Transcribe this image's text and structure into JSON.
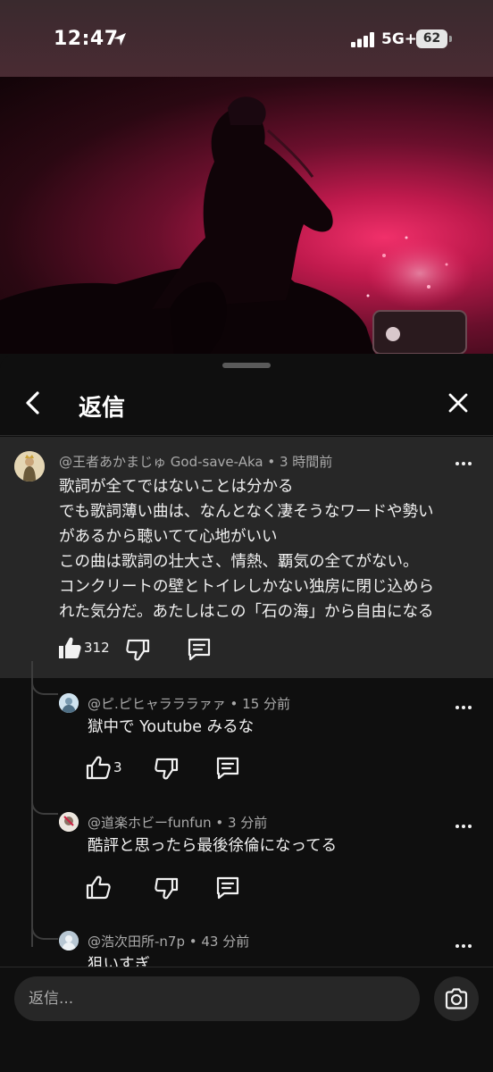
{
  "status_bar": {
    "time": "12:47",
    "network": "5G+",
    "battery": "62"
  },
  "sheet": {
    "title": "返信",
    "back_icon": "chevron-left-icon",
    "close_icon": "close-icon"
  },
  "main_comment": {
    "author": "@王者あかまじゅ God-save-Aka",
    "time": "3 時間前",
    "meta": "@王者あかまじゅ God-save-Aka • 3 時間前",
    "lines": [
      "歌詞が全てではないことは分かる",
      "でも歌詞薄い曲は、なんとなく凄そうなワードや勢い",
      "があるから聴いてて心地がいい",
      "この曲は歌詞の壮大さ、情熱、覇気の全てがない。",
      "コンクリートの壁とトイレしかない独房に閉じ込めら",
      "れた気分だ。あたしはこの「石の海」から自由になる"
    ],
    "likes": "312"
  },
  "replies": [
    {
      "author": "@ピ.ピヒャラララァァ",
      "time": "15 分前",
      "meta": "@ピ.ピヒャラララァァ • 15 分前",
      "text": "獄中で Youtube みるな",
      "likes": "3"
    },
    {
      "author": "@道楽ホビーfunfun",
      "time": "3 分前",
      "meta": "@道楽ホビーfunfun • 3 分前",
      "text": "酷評と思ったら最後徐倫になってる",
      "likes": ""
    },
    {
      "author": "@浩次田所-n7p",
      "time": "43 分前",
      "meta": "@浩次田所-n7p • 43 分前",
      "text": "狙いすぎ",
      "likes": ""
    }
  ],
  "input": {
    "placeholder": "返信..."
  },
  "colors": {
    "background": "#0f0f0f",
    "highlight": "#272727",
    "meta_text": "#aaaaaa",
    "video_accent": "#e0245e"
  }
}
